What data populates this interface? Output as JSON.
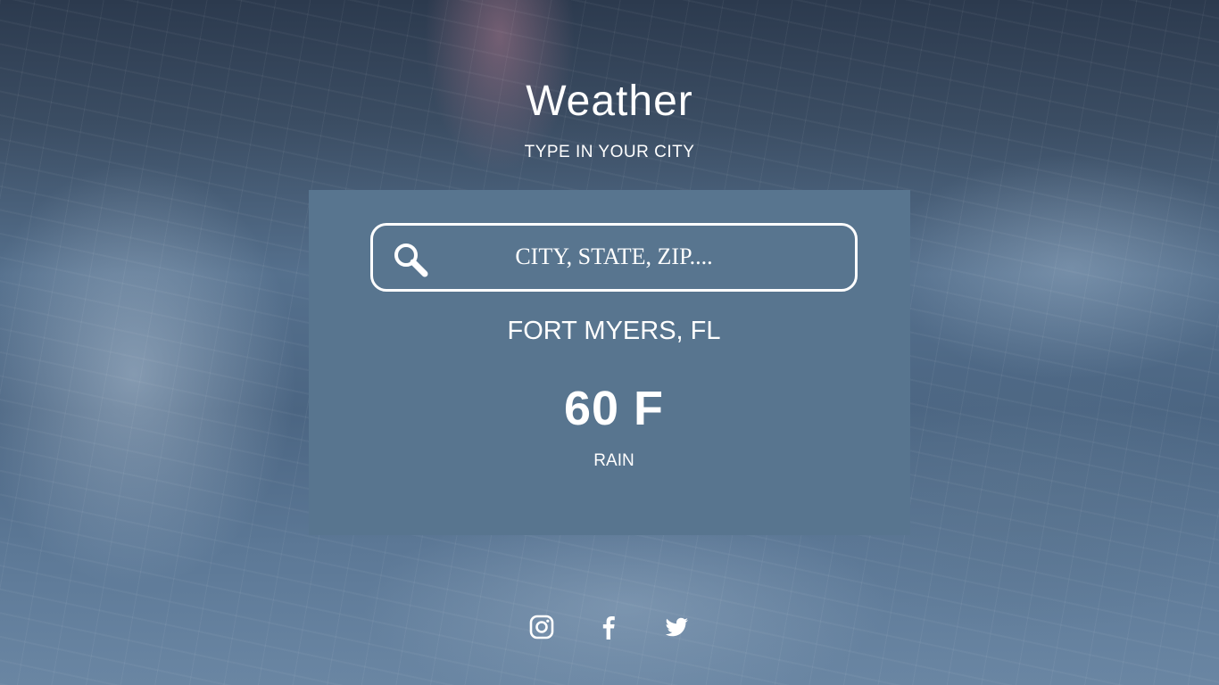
{
  "header": {
    "title": "Weather",
    "subtitle": "TYPE IN YOUR CITY"
  },
  "search": {
    "placeholder": "CITY, STATE, ZIP....",
    "value": "",
    "icon": "search-icon"
  },
  "weather": {
    "location": "FORT MYERS, FL",
    "temperature": "60 F",
    "condition": "RAIN"
  },
  "social": {
    "items": [
      {
        "name": "instagram",
        "icon": "instagram-icon"
      },
      {
        "name": "facebook",
        "icon": "facebook-icon"
      },
      {
        "name": "twitter",
        "icon": "twitter-icon"
      }
    ]
  },
  "colors": {
    "card_background": "#58758f",
    "text": "#ffffff"
  }
}
